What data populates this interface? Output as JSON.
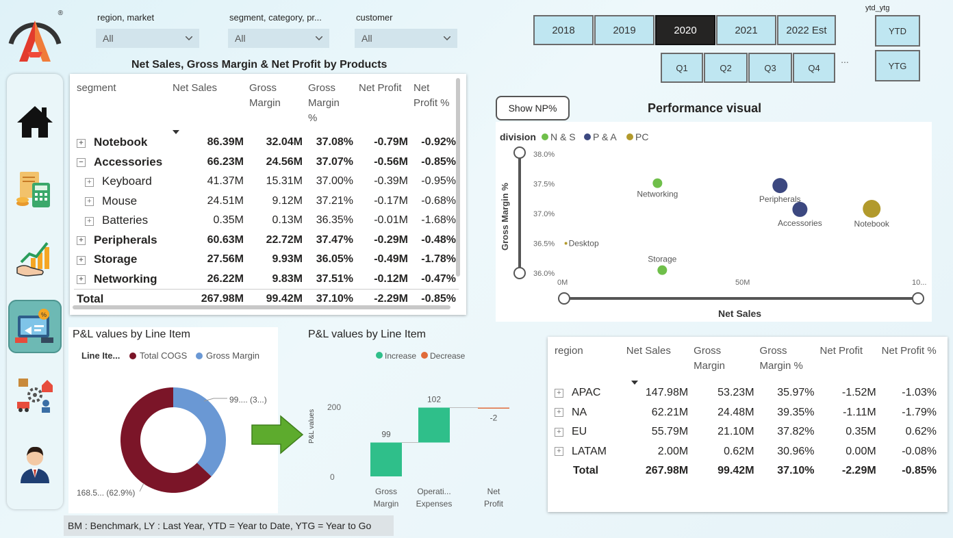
{
  "logo": {
    "registered": "®"
  },
  "filters": [
    {
      "label": "region, market",
      "value": "All"
    },
    {
      "label": "segment, category, pr...",
      "value": "All"
    },
    {
      "label": "customer",
      "value": "All"
    }
  ],
  "years": [
    "2018",
    "2019",
    "2020",
    "2021",
    "2022 Est"
  ],
  "selected_year": "2020",
  "quarters": [
    "Q1",
    "Q2",
    "Q3",
    "Q4"
  ],
  "more_label": "...",
  "ytd_ytg": {
    "label": "ytd_ytg",
    "options": [
      "YTD",
      "YTG"
    ]
  },
  "products_table": {
    "title": "Net Sales, Gross Margin & Net Profit by Products",
    "headers": [
      "segment",
      "Net Sales",
      "Gross Margin",
      "Gross Margin %",
      "Net Profit",
      "Net Profit %"
    ],
    "rows": [
      {
        "name": "Notebook",
        "level": 0,
        "expander": "+",
        "values": [
          "86.39M",
          "32.04M",
          "37.08%",
          "-0.79M",
          "-0.92%"
        ]
      },
      {
        "name": "Accessories",
        "level": 0,
        "expander": "−",
        "values": [
          "66.23M",
          "24.56M",
          "37.07%",
          "-0.56M",
          "-0.85%"
        ]
      },
      {
        "name": "Keyboard",
        "level": 1,
        "expander": "+",
        "values": [
          "41.37M",
          "15.31M",
          "37.00%",
          "-0.39M",
          "-0.95%"
        ]
      },
      {
        "name": "Mouse",
        "level": 1,
        "expander": "+",
        "values": [
          "24.51M",
          "9.12M",
          "37.21%",
          "-0.17M",
          "-0.68%"
        ]
      },
      {
        "name": "Batteries",
        "level": 1,
        "expander": "+",
        "values": [
          "0.35M",
          "0.13M",
          "36.35%",
          "-0.01M",
          "-1.68%"
        ]
      },
      {
        "name": "Peripherals",
        "level": 0,
        "expander": "+",
        "values": [
          "60.63M",
          "22.72M",
          "37.47%",
          "-0.29M",
          "-0.48%"
        ]
      },
      {
        "name": "Storage",
        "level": 0,
        "expander": "+",
        "values": [
          "27.56M",
          "9.93M",
          "36.05%",
          "-0.49M",
          "-1.78%"
        ]
      },
      {
        "name": "Networking",
        "level": 0,
        "expander": "+",
        "values": [
          "26.22M",
          "9.83M",
          "37.51%",
          "-0.12M",
          "-0.47%"
        ]
      }
    ],
    "total": {
      "name": "Total",
      "values": [
        "267.98M",
        "99.42M",
        "37.10%",
        "-2.29M",
        "-0.85%"
      ]
    }
  },
  "show_np_button": "Show NP%",
  "performance": {
    "title": "Performance visual",
    "legend_title": "division",
    "legend": [
      {
        "name": "N & S",
        "color": "#6fbf4a"
      },
      {
        "name": "P & A",
        "color": "#3c4880"
      },
      {
        "name": "PC",
        "color": "#b29a2c"
      }
    ],
    "ylabel": "Gross Margin %",
    "xlabel": "Net Sales",
    "yticks": [
      "38.0%",
      "37.5%",
      "37.0%",
      "36.5%",
      "36.0%"
    ],
    "xticks": [
      "0M",
      "50M",
      "10..."
    ]
  },
  "chart_data": [
    {
      "type": "scatter",
      "title": "Performance visual",
      "xlabel": "Net Sales",
      "ylabel": "Gross Margin %",
      "xlim": [
        0,
        100
      ],
      "ylim": [
        36.0,
        38.0
      ],
      "points": [
        {
          "label": "Networking",
          "x": 26.22,
          "y": 37.51,
          "series": "N & S",
          "color": "#6fbf4a",
          "r": 7
        },
        {
          "label": "Storage",
          "x": 27.56,
          "y": 36.05,
          "series": "N & S",
          "color": "#6fbf4a",
          "r": 7
        },
        {
          "label": "Peripherals",
          "x": 60.63,
          "y": 37.47,
          "series": "P & A",
          "color": "#3c4880",
          "r": 11
        },
        {
          "label": "Accessories",
          "x": 66.23,
          "y": 37.07,
          "series": "P & A",
          "color": "#3c4880",
          "r": 11
        },
        {
          "label": "Notebook",
          "x": 86.39,
          "y": 37.08,
          "series": "PC",
          "color": "#b29a2c",
          "r": 13
        },
        {
          "label": "Desktop",
          "x": 0.5,
          "y": 36.5,
          "series": "PC",
          "color": "#b29a2c",
          "r": 2
        }
      ]
    },
    {
      "type": "pie",
      "title": "P&L values by Line Item",
      "legend_title": "Line Ite...",
      "series": [
        {
          "name": "Total COGS",
          "value": 168.5,
          "label": "168.5... (62.9%)",
          "color": "#7b1528"
        },
        {
          "name": "Gross Margin",
          "value": 99.4,
          "label": "99.... (3...)",
          "color": "#6a98d4"
        }
      ]
    },
    {
      "type": "bar",
      "title": "P&L values by Line Item",
      "ylabel": "P&L values",
      "ylim": [
        0,
        250
      ],
      "yticks": [
        0,
        200
      ],
      "legend": [
        {
          "name": "Increase",
          "color": "#2fbf8a"
        },
        {
          "name": "Decrease",
          "color": "#e06b3a"
        }
      ],
      "categories": [
        [
          "Gross",
          "Margin"
        ],
        [
          "Operati...",
          "Expenses"
        ],
        [
          "Net",
          "Profit"
        ]
      ],
      "bars": [
        {
          "start": 0,
          "end": 99,
          "label": "99",
          "kind": "Increase"
        },
        {
          "start": 99,
          "end": 201,
          "label": "102",
          "kind": "Increase"
        },
        {
          "start": 201,
          "end": 199,
          "label": "-2",
          "kind": "Decrease"
        }
      ]
    }
  ],
  "pl_donut": {
    "title": "P&L values by Line Item",
    "legend_title": "Line Ite...",
    "legend": [
      "Total COGS",
      "Gross Margin"
    ],
    "labels": [
      "99.... (3...)",
      "168.5... (62.9%)"
    ]
  },
  "pl_waterfall": {
    "title": "P&L values by Line Item",
    "legend": [
      "Increase",
      "Decrease"
    ],
    "ylabel": "P&L values",
    "yticks": [
      "200",
      "0"
    ],
    "bar_labels": [
      "99",
      "102",
      "-2"
    ],
    "categories": [
      "Gross Margin",
      "Operati... Expenses",
      "Net Profit"
    ]
  },
  "region_table": {
    "headers": [
      "region",
      "Net Sales",
      "Gross Margin",
      "Gross Margin %",
      "Net Profit",
      "Net Profit %"
    ],
    "rows": [
      {
        "name": "APAC",
        "values": [
          "147.98M",
          "53.23M",
          "35.97%",
          "-1.52M",
          "-1.03%"
        ]
      },
      {
        "name": "NA",
        "values": [
          "62.21M",
          "24.48M",
          "39.35%",
          "-1.11M",
          "-1.79%"
        ]
      },
      {
        "name": "EU",
        "values": [
          "55.79M",
          "21.10M",
          "37.82%",
          "0.35M",
          "0.62%"
        ]
      },
      {
        "name": "LATAM",
        "values": [
          "2.00M",
          "0.62M",
          "30.96%",
          "0.00M",
          "-0.08%"
        ]
      }
    ],
    "total": {
      "name": "Total",
      "values": [
        "267.98M",
        "99.42M",
        "37.10%",
        "-2.29M",
        "-0.85%"
      ]
    }
  },
  "footer": "BM : Benchmark, LY : Last Year, YTD = Year to Date, YTG = Year to Go"
}
